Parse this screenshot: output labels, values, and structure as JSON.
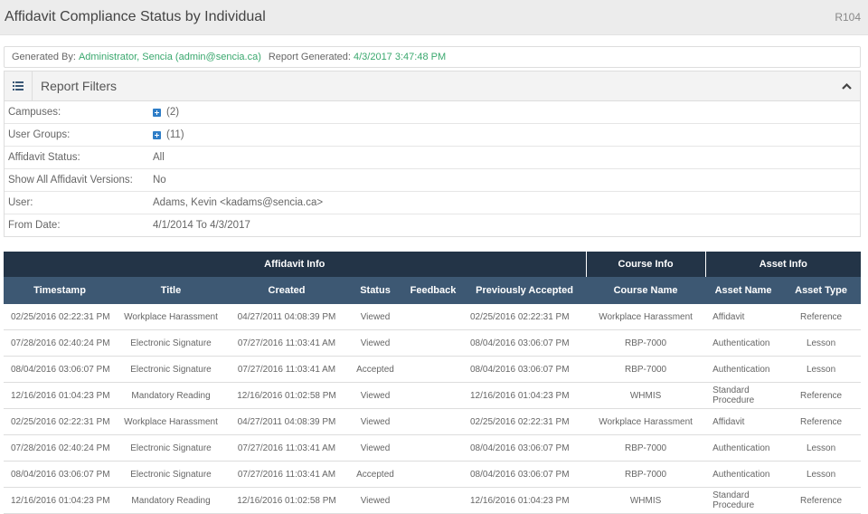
{
  "header": {
    "title": "Affidavit Compliance Status by Individual",
    "code": "R104"
  },
  "generated": {
    "by_label": "Generated By:",
    "by_value": "Administrator, Sencia (admin@sencia.ca)",
    "date_label": "Report Generated:",
    "date_value": "4/3/2017 3:47:48 PM"
  },
  "filters": {
    "title": "Report Filters",
    "icon": "list-icon",
    "toggle_icon": "chevron-up-icon",
    "rows": [
      {
        "label": "Campuses:",
        "value": "(2)",
        "expandable": true
      },
      {
        "label": "User Groups:",
        "value": "(11)",
        "expandable": true
      },
      {
        "label": "Affidavit Status:",
        "value": "All"
      },
      {
        "label": "Show All Affidavit Versions:",
        "value": "No"
      },
      {
        "label": "User:",
        "value": "Adams, Kevin <kadams@sencia.ca>"
      },
      {
        "label": "From Date:",
        "value": "4/1/2014 To 4/3/2017"
      }
    ]
  },
  "table": {
    "groups": [
      "Affidavit Info",
      "Course Info",
      "Asset Info"
    ],
    "columns": [
      "Timestamp",
      "Title",
      "Created",
      "Status",
      "Feedback",
      "Previously Accepted",
      "Course Name",
      "Asset Name",
      "Asset Type"
    ],
    "rows": [
      [
        "02/25/2016 02:22:31 PM",
        "Workplace Harassment",
        "04/27/2011 04:08:39 PM",
        "Viewed",
        "",
        "02/25/2016 02:22:31 PM",
        "Workplace Harassment",
        "Affidavit",
        "Reference"
      ],
      [
        "07/28/2016 02:40:24 PM",
        "Electronic Signature",
        "07/27/2016 11:03:41 AM",
        "Viewed",
        "",
        "08/04/2016 03:06:07 PM",
        "RBP-7000",
        "Authentication",
        "Lesson"
      ],
      [
        "08/04/2016 03:06:07 PM",
        "Electronic Signature",
        "07/27/2016 11:03:41 AM",
        "Accepted",
        "",
        "08/04/2016 03:06:07 PM",
        "RBP-7000",
        "Authentication",
        "Lesson"
      ],
      [
        "12/16/2016 01:04:23 PM",
        "Mandatory Reading",
        "12/16/2016 01:02:58 PM",
        "Viewed",
        "",
        "12/16/2016 01:04:23 PM",
        "WHMIS",
        "Standard Procedure",
        "Reference"
      ],
      [
        "02/25/2016 02:22:31 PM",
        "Workplace Harassment",
        "04/27/2011 04:08:39 PM",
        "Viewed",
        "",
        "02/25/2016 02:22:31 PM",
        "Workplace Harassment",
        "Affidavit",
        "Reference"
      ],
      [
        "07/28/2016 02:40:24 PM",
        "Electronic Signature",
        "07/27/2016 11:03:41 AM",
        "Viewed",
        "",
        "08/04/2016 03:06:07 PM",
        "RBP-7000",
        "Authentication",
        "Lesson"
      ],
      [
        "08/04/2016 03:06:07 PM",
        "Electronic Signature",
        "07/27/2016 11:03:41 AM",
        "Accepted",
        "",
        "08/04/2016 03:06:07 PM",
        "RBP-7000",
        "Authentication",
        "Lesson"
      ],
      [
        "12/16/2016 01:04:23 PM",
        "Mandatory Reading",
        "12/16/2016 01:02:58 PM",
        "Viewed",
        "",
        "12/16/2016 01:04:23 PM",
        "WHMIS",
        "Standard Procedure",
        "Reference"
      ]
    ]
  }
}
